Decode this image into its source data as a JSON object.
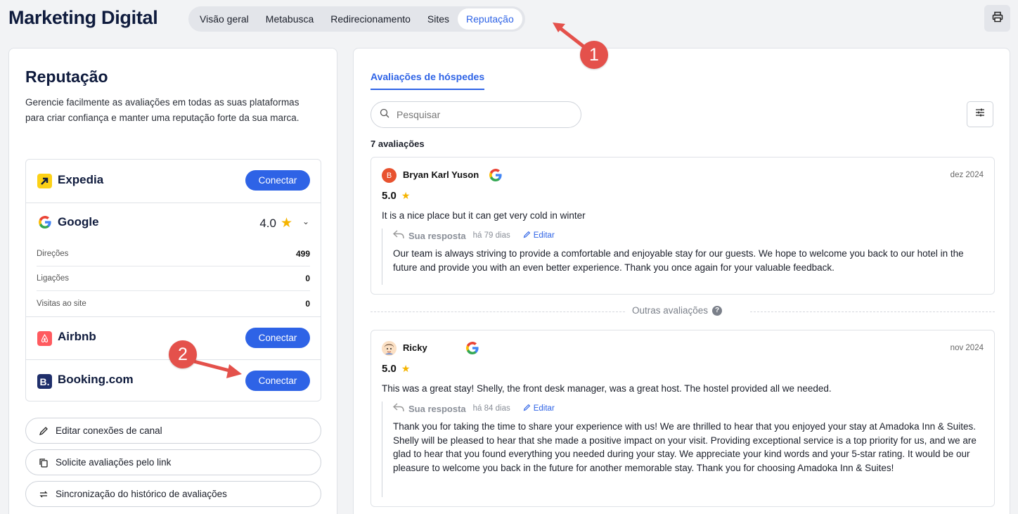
{
  "header": {
    "title": "Marketing Digital",
    "tabs": [
      {
        "label": "Visão geral",
        "active": false
      },
      {
        "label": "Metabusca",
        "active": false
      },
      {
        "label": "Redirecionamento",
        "active": false
      },
      {
        "label": "Sites",
        "active": false
      },
      {
        "label": "Reputação",
        "active": true
      }
    ],
    "print_icon": "printer-icon"
  },
  "left": {
    "title": "Reputação",
    "description": "Gerencie facilmente as avaliações em todas as suas plataformas para criar confiança e manter uma reputação forte da sua marca.",
    "channels": {
      "expedia": {
        "name": "Expedia",
        "button": "Conectar"
      },
      "google": {
        "name": "Google",
        "rating": "4.0",
        "metrics": [
          {
            "label": "Direções",
            "value": "499"
          },
          {
            "label": "Ligações",
            "value": "0"
          },
          {
            "label": "Visitas ao site",
            "value": "0"
          }
        ]
      },
      "airbnb": {
        "name": "Airbnb",
        "button": "Conectar"
      },
      "booking": {
        "name": "Booking.com",
        "button": "Conectar"
      }
    },
    "actions": {
      "edit_connections": "Editar conexões de canal",
      "request_reviews": "Solicite avaliações pelo link",
      "sync_history": "Sincronização do histórico de avaliações"
    }
  },
  "right": {
    "tab": "Avaliações de hóspedes",
    "search_placeholder": "Pesquisar",
    "count": "7 avaliações",
    "other_reviews": "Outras avaliações",
    "reviews": [
      {
        "avatar_letter": "B",
        "author": "Bryan Karl Yuson",
        "date": "dez 2024",
        "score": "5.0",
        "text": "It is a nice place but it can get very cold in winter",
        "reply_label": "Sua resposta",
        "reply_ago": "há 79 dias",
        "edit_label": "Editar",
        "reply_text": "Our team is always striving to provide a comfortable and enjoyable stay for our guests. We hope to welcome you back to our hotel in the future and provide you with an even better experience. Thank you once again for your valuable feedback."
      },
      {
        "author": "Ricky",
        "date": "nov 2024",
        "score": "5.0",
        "text": "This was a great stay! Shelly, the front desk manager, was a great host. The hostel provided all we needed.",
        "reply_label": "Sua resposta",
        "reply_ago": "há 84 dias",
        "edit_label": "Editar",
        "reply_text": "Thank you for taking the time to share your experience with us! We are thrilled to hear that you enjoyed your stay at Amadoka Inn & Suites. Shelly will be pleased to hear that she made a positive impact on your visit. Providing exceptional service is a top priority for us, and we are glad to hear that you found everything you needed during your stay. We appreciate your kind words and your 5-star rating. It would be our pleasure to welcome you back in the future for another memorable stay. Thank you for choosing Amadoka Inn & Suites!"
      }
    ]
  },
  "annotations": {
    "step1": "1",
    "step2": "2"
  },
  "colors": {
    "accent": "#2e63e6",
    "badge": "#e4514b",
    "star": "#f5b400"
  }
}
